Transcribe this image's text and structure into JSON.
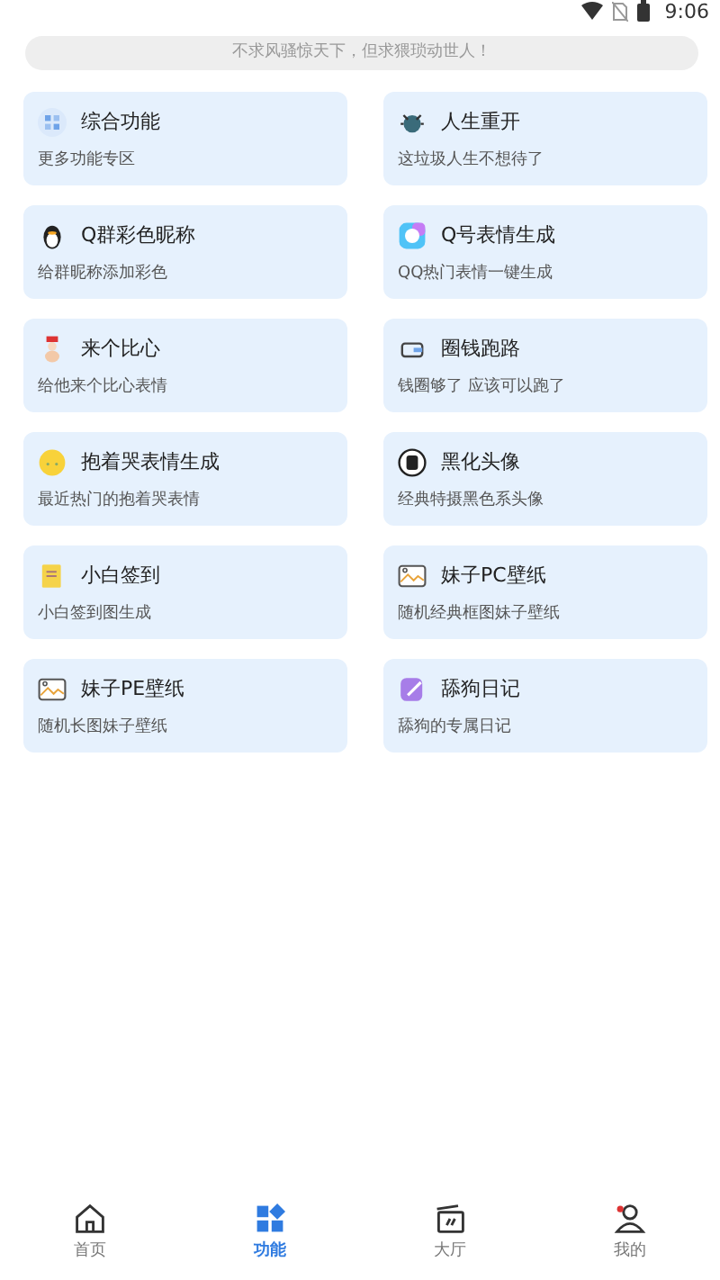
{
  "status_bar": {
    "time": "9:06"
  },
  "banner": {
    "text": "不求风骚惊天下，但求猥琐动世人！"
  },
  "cards": [
    {
      "title": "综合功能",
      "subtitle": "更多功能专区"
    },
    {
      "title": "人生重开",
      "subtitle": "这垃圾人生不想待了"
    },
    {
      "title": "Q群彩色昵称",
      "subtitle": "给群昵称添加彩色"
    },
    {
      "title": "Q号表情生成",
      "subtitle": "QQ热门表情一键生成"
    },
    {
      "title": "来个比心",
      "subtitle": "给他来个比心表情"
    },
    {
      "title": "圈钱跑路",
      "subtitle": "钱圈够了 应该可以跑了"
    },
    {
      "title": "抱着哭表情生成",
      "subtitle": "最近热门的抱着哭表情"
    },
    {
      "title": "黑化头像",
      "subtitle": "经典特摄黑色系头像"
    },
    {
      "title": "小白签到",
      "subtitle": "小白签到图生成"
    },
    {
      "title": "妹子PC壁纸",
      "subtitle": "随机经典框图妹子壁纸"
    },
    {
      "title": "妹子PE壁纸",
      "subtitle": "随机长图妹子壁纸"
    },
    {
      "title": "舔狗日记",
      "subtitle": "舔狗的专属日记"
    }
  ],
  "tab_bar": [
    {
      "label": "首页",
      "selected": false
    },
    {
      "label": "功能",
      "selected": true
    },
    {
      "label": "大厅",
      "selected": false
    },
    {
      "label": "我的",
      "selected": false
    }
  ]
}
